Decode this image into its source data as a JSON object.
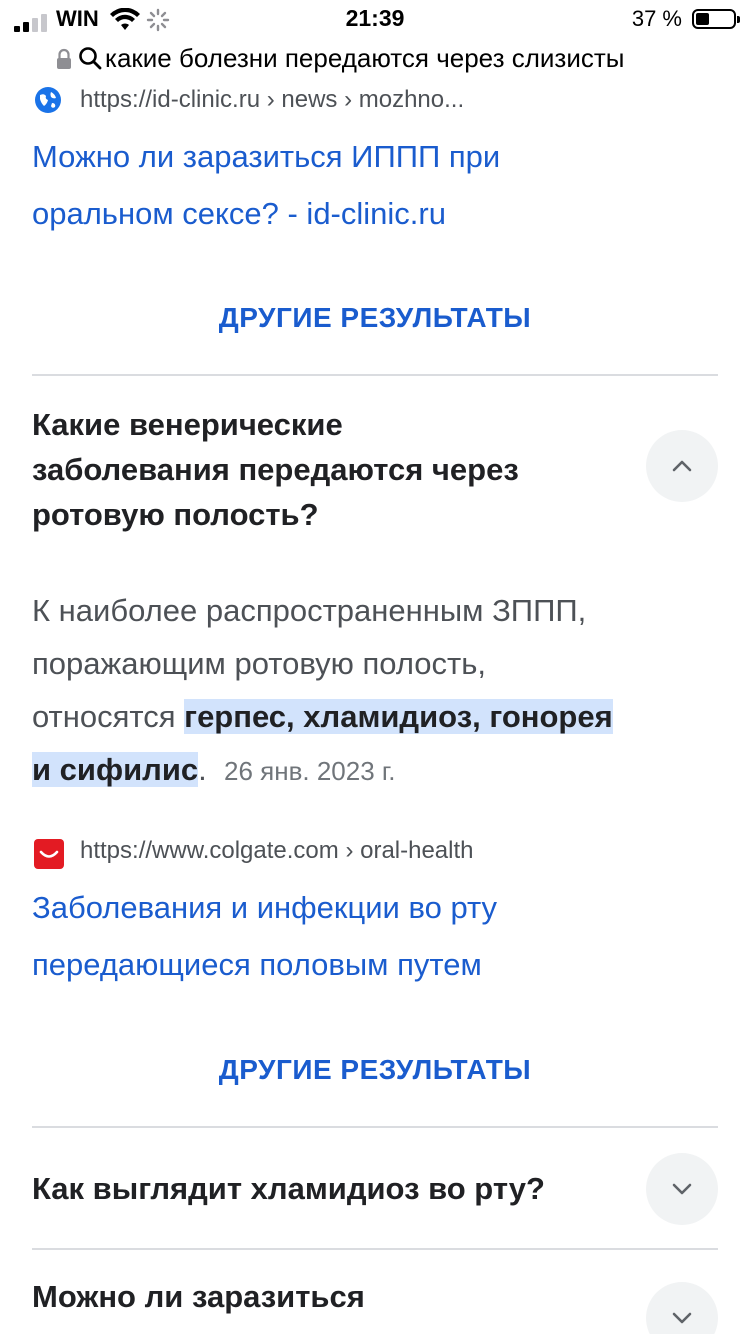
{
  "status_bar": {
    "carrier": "WIN",
    "time": "21:39",
    "battery_text": "37 %",
    "battery_level": 0.37
  },
  "url_bar": {
    "query": "какие болезни передаются через слизисты"
  },
  "results": [
    {
      "cite": "https://id-clinic.ru › news › mozhno...",
      "favicon": "globe-icon",
      "title_line1": "Можно ли заразиться ИППП при",
      "title_line2": "оральном сексе? - id-clinic.ru"
    },
    {
      "cite": "https://www.colgate.com › oral-health",
      "favicon": "colgate-icon",
      "title_line1": "Заболевания и инфекции во рту",
      "title_line2": "передающиеся половым путем"
    }
  ],
  "more_results_label": "ДРУГИЕ РЕЗУЛЬТАТЫ",
  "faq": [
    {
      "question_lines": [
        "Какие венерические",
        "заболевания передаются через",
        "ротовую полость?"
      ],
      "expanded": true,
      "answer": {
        "line1": "К наиболее распространенным ЗППП,",
        "line2": "поражающим ротовую полость,",
        "line3_plain": "относятся ",
        "line3_highlight": "герпес, хламидиоз, гонорея",
        "line4_highlight": "и сифилис",
        "line4_tail": ".",
        "date": "26 янв. 2023 г."
      }
    },
    {
      "question_lines": [
        "Как выглядит хламидиоз во рту?"
      ],
      "expanded": false
    },
    {
      "question_lines": [
        "Можно ли заразиться"
      ],
      "expanded": false
    }
  ],
  "colors": {
    "link": "#1a5cce",
    "highlight": "#d2e3fc",
    "colgate_red": "#e31b23"
  }
}
